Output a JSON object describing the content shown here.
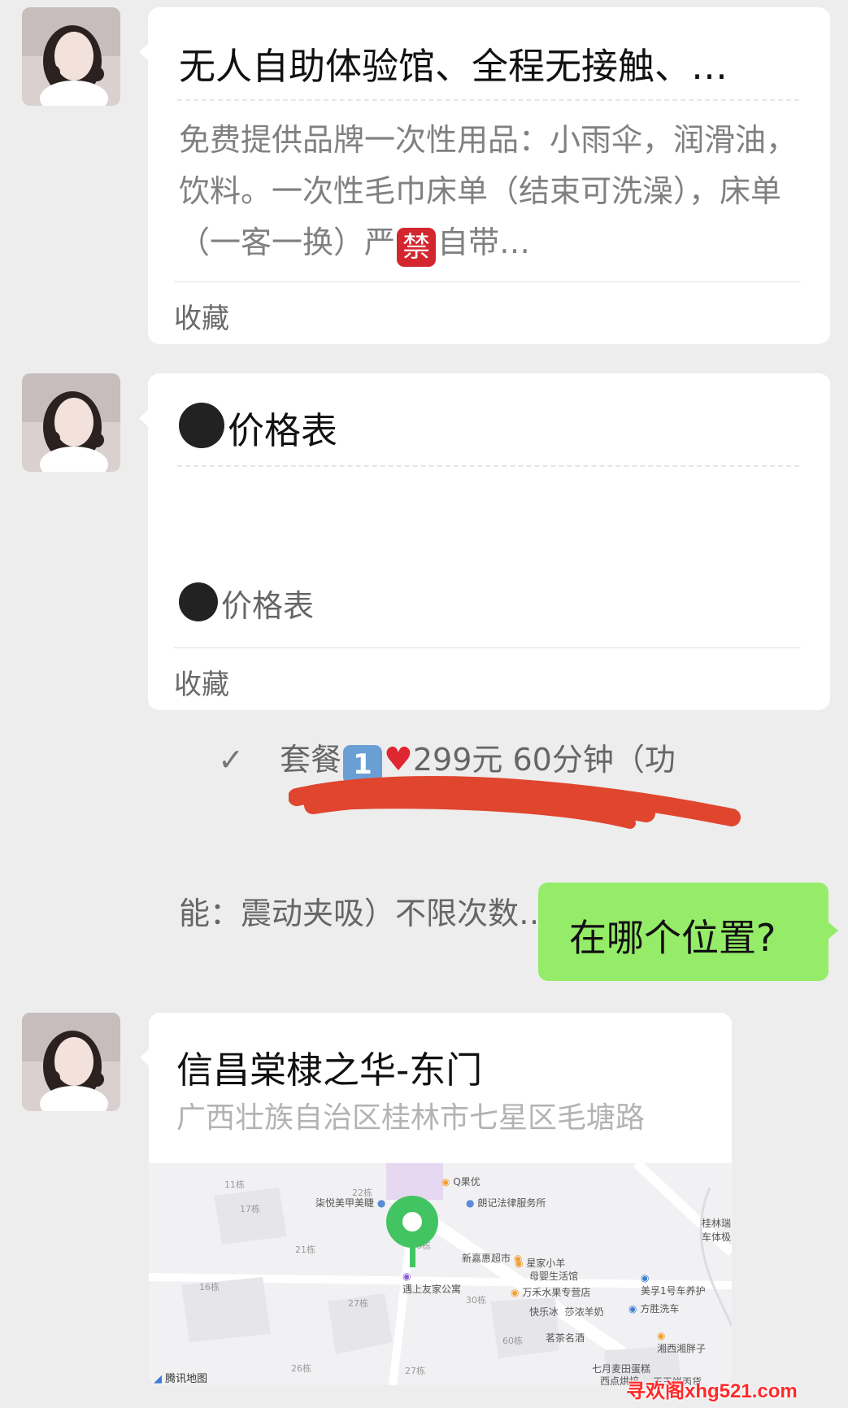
{
  "messages": [
    {
      "title": "无人自助体验馆、全程无接触、…",
      "desc_pre": "免费提供品牌一次性用品：小雨伞，润滑油，饮料。一次性毛巾床单（结束可洗澡），床单（一客一换）严",
      "desc_emoji": "禁",
      "desc_post": "自带…",
      "footer": "收藏"
    },
    {
      "title": "价格表",
      "line1": "价格表",
      "line2_check": "✓",
      "line2_a": "套餐",
      "line2_num": "1",
      "line2_b": "299元 60分钟（功",
      "line3": "能：震动夹吸）不限次数…",
      "footer": "收藏"
    },
    {
      "reply": "在哪个位置?"
    },
    {
      "title": "信昌棠棣之华-东门",
      "address": "广西壮族自治区桂林市七星区毛塘路"
    }
  ],
  "map": {
    "pois": [
      "Q果优",
      "朗记法律服务所",
      "柒悦美甲美睫",
      "新嘉惠超市",
      "星家小羊",
      "母婴生活馆",
      "万禾水果专营店",
      "快乐冰",
      "莎浓羊奶",
      "茗茶名酒",
      "七月麦田蛋糕",
      "西点烘焙",
      "遇上友家公寓",
      "美孚1号车养护",
      "方胜洗车",
      "湘西湘胖子",
      "桂林瑞",
      "车体极",
      "芜",
      "王王饼丙货"
    ],
    "buildings": [
      "11栋",
      "22栋",
      "17栋",
      "21栋",
      "16栋",
      "27栋",
      "28栋",
      "30栋",
      "60栋",
      "26栋",
      "27栋"
    ],
    "provider": "腾讯地图"
  },
  "watermark": "寻欢阁xhg521.com",
  "colors": {
    "bg": "#ededed",
    "me_bubble": "#95ec69",
    "pin": "#43c463"
  }
}
